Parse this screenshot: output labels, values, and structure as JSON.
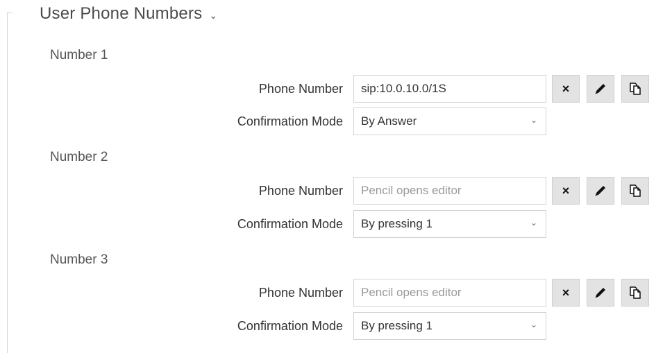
{
  "section": {
    "title": "User Phone Numbers",
    "chevron": "chevron-down-icon"
  },
  "numbers": [
    {
      "title": "Number 1",
      "phone_label": "Phone Number",
      "phone_value": "sip:10.0.10.0/1S",
      "phone_placeholder": "",
      "mode_label": "Confirmation Mode",
      "mode_value": "By Answer"
    },
    {
      "title": "Number 2",
      "phone_label": "Phone Number",
      "phone_value": "",
      "phone_placeholder": "Pencil opens editor",
      "mode_label": "Confirmation Mode",
      "mode_value": "By pressing 1"
    },
    {
      "title": "Number 3",
      "phone_label": "Phone Number",
      "phone_value": "",
      "phone_placeholder": "Pencil opens editor",
      "mode_label": "Confirmation Mode",
      "mode_value": "By pressing 1"
    }
  ],
  "buttons": {
    "clear_glyph": "×",
    "clear_icon": "close-icon",
    "edit_icon": "pencil-icon",
    "copy_icon": "copy-icon"
  },
  "colors": {
    "button_bg": "#e3e3e3",
    "border": "#d3d3d3",
    "text": "#333333"
  }
}
